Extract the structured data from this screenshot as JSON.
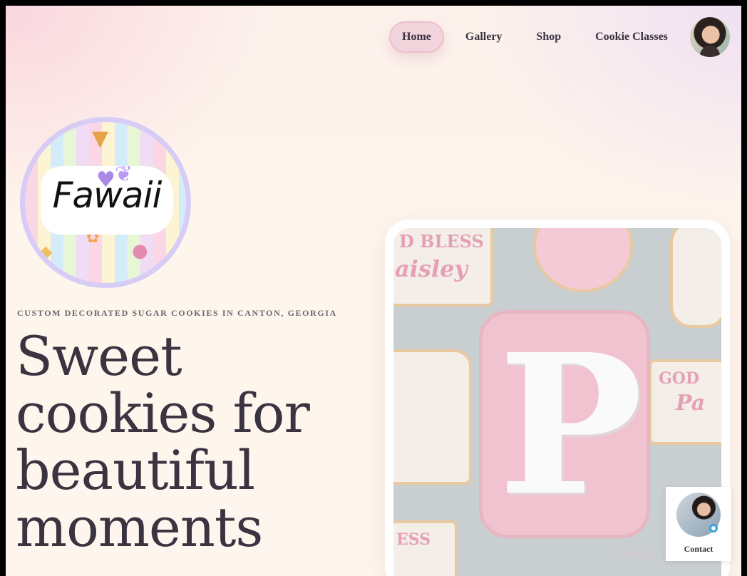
{
  "nav": {
    "items": [
      {
        "label": "Home",
        "active": true
      },
      {
        "label": "Gallery",
        "active": false
      },
      {
        "label": "Shop",
        "active": false
      },
      {
        "label": "Cookie Classes",
        "active": false
      }
    ]
  },
  "logo": {
    "wordmark": "Fawaii"
  },
  "hero": {
    "eyebrow": "CUSTOM DECORATED SUGAR COOKIES IN CANTON, GEORGIA",
    "headline": "Sweet cookies for beautiful moments"
  },
  "photo": {
    "cookie_text_1": "D BLESS",
    "cookie_text_2": "aisley",
    "cookie_text_3": "GOD",
    "cookie_text_4": "Pa",
    "cookie_text_5": "ESS",
    "letter": "P",
    "watermark": "Fawaii"
  },
  "contact": {
    "label": "Contact"
  },
  "colors": {
    "accent_pink": "#f2d4dc",
    "text_dark": "#3a3340",
    "logo_ring": "#d6ccf6"
  }
}
